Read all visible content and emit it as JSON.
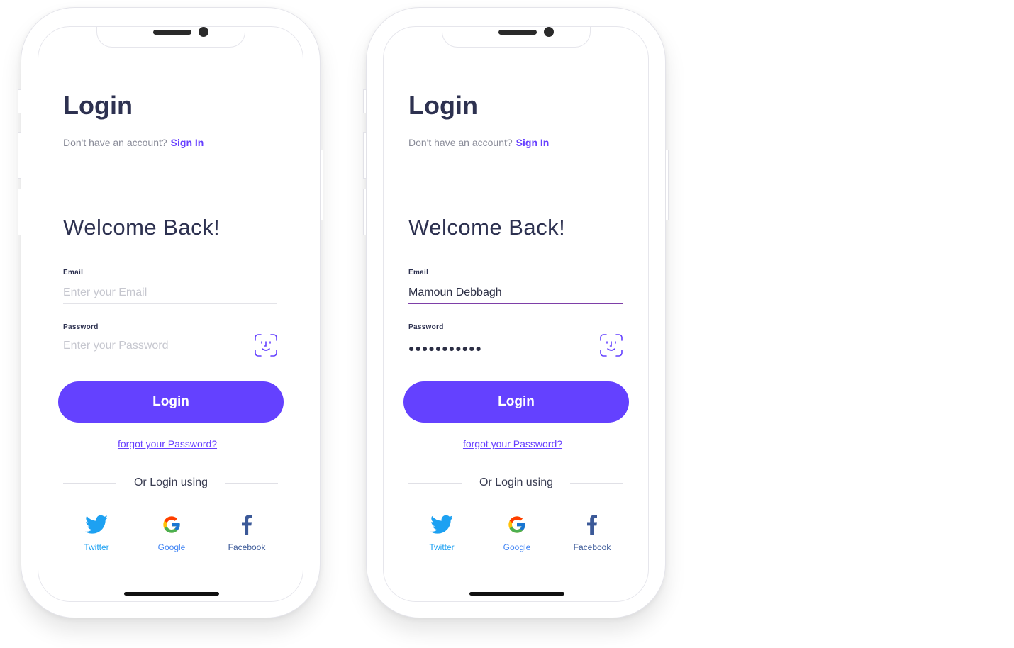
{
  "phones": [
    {
      "title": "Login",
      "subtitle": "Don't have an account?",
      "signin_link": "Sign In",
      "welcome": "Welcome Back!",
      "email_label": "Email",
      "email_placeholder": "Enter your Email",
      "email_value": "",
      "password_label": "Password",
      "password_placeholder": "Enter your Password",
      "password_value": "",
      "login_button": "Login",
      "forgot_link": "forgot your Password?",
      "or_text": "Or Login using",
      "social": [
        {
          "label": "Twitter",
          "icon": "twitter-icon",
          "color": "#1da1f2"
        },
        {
          "label": "Google",
          "icon": "google-icon",
          "color": "#4285f4"
        },
        {
          "label": "Facebook",
          "icon": "facebook-icon",
          "color": "#3b5998"
        }
      ]
    },
    {
      "title": "Login",
      "subtitle": "Don't have an account?",
      "signin_link": "Sign In",
      "welcome": "Welcome Back!",
      "email_label": "Email",
      "email_placeholder": "",
      "email_value": "Mamoun Debbagh",
      "password_label": "Password",
      "password_placeholder": "",
      "password_value": "●●●●●●●●●●●",
      "login_button": "Login",
      "forgot_link": "forgot your Password?",
      "or_text": "Or Login using",
      "social": [
        {
          "label": "Twitter",
          "icon": "twitter-icon",
          "color": "#1da1f2"
        },
        {
          "label": "Google",
          "icon": "google-icon",
          "color": "#4285f4"
        },
        {
          "label": "Facebook",
          "icon": "facebook-icon",
          "color": "#3b5998"
        }
      ]
    }
  ],
  "colors": {
    "accent": "#6441ff",
    "heading": "#2d3150",
    "muted": "#8a8c99",
    "active_underline": "#7e3fa8"
  }
}
